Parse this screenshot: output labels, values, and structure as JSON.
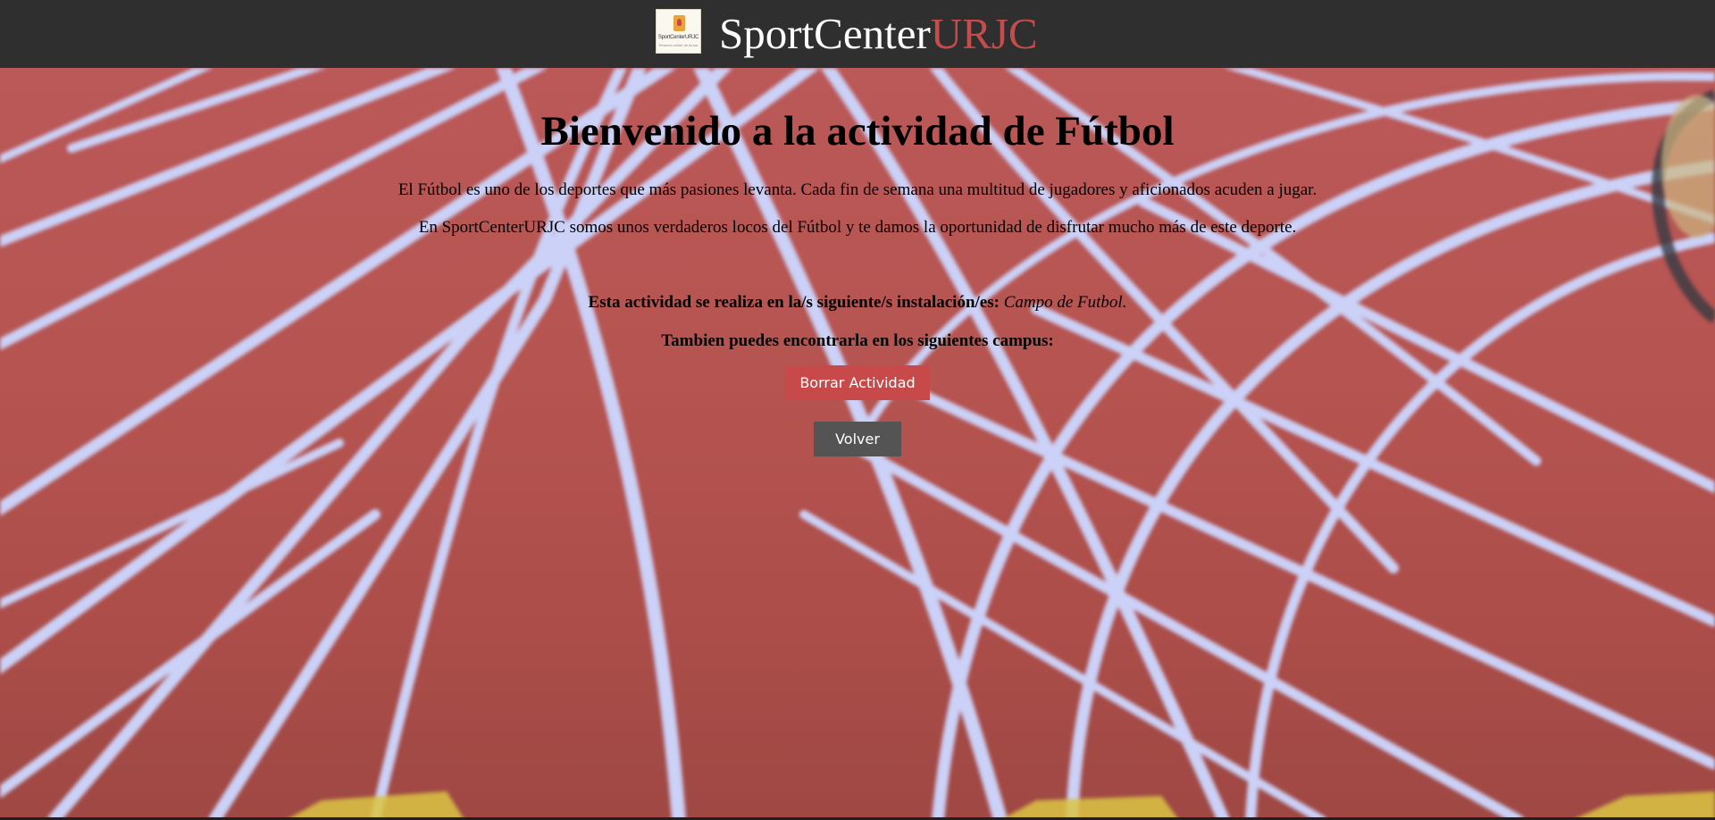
{
  "header": {
    "brand_main": "SportCenter",
    "brand_accent": "URJC",
    "logo_text": "SportCenterURJC",
    "logo_tagline": "Reserva online de forma",
    "logo_icon": "sportcenter-logo-icon"
  },
  "activity": {
    "title": "Bienvenido a la actividad de Fútbol",
    "intro_1": "El Fútbol es uno de los deportes que más pasiones levanta. Cada fin de semana una multitud de jugadores y aficionados acuden a jugar.",
    "intro_2": "En SportCenterURJC somos unos verdaderos locos del Fútbol y te damos la oportunidad de disfrutar mucho más de este deporte.",
    "facility_label": "Esta actividad se realiza en la/s siguiente/s instalación/es:",
    "facility_value": "Campo de Futbol.",
    "campus_label": "Tambien puedes encontrarla en los siguientes campus:"
  },
  "actions": {
    "delete_label": "Borrar Actividad",
    "back_label": "Volver"
  },
  "colors": {
    "header_bg": "#2f2f2f",
    "brand_accent": "#c64b4b",
    "delete_button": "#c8494a",
    "back_button": "#545454",
    "track_red": "#b24b47"
  }
}
